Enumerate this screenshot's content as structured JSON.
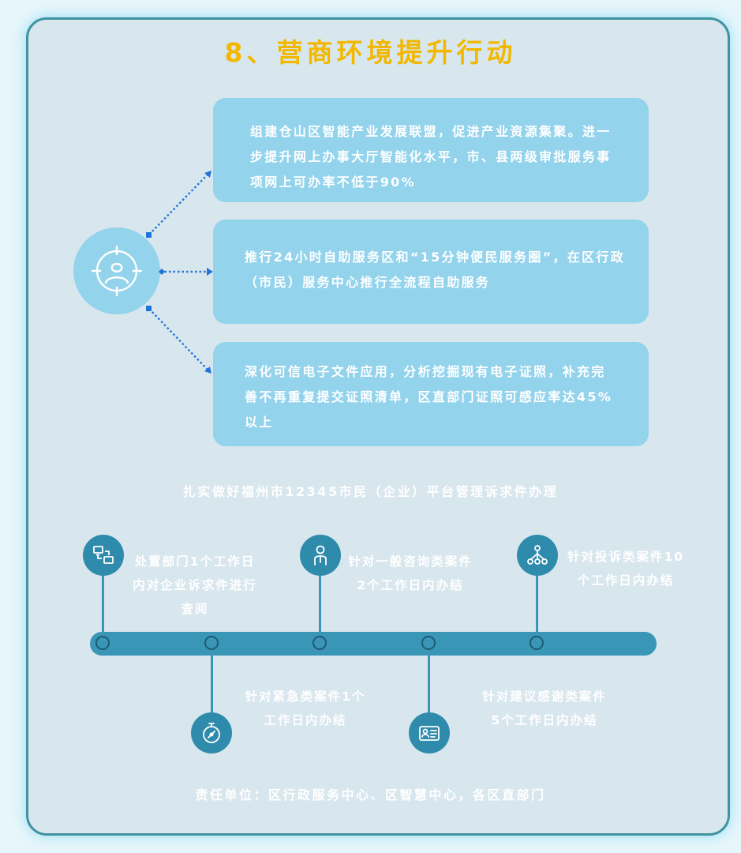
{
  "title": "8、营商环境提升行动",
  "actions": [
    "组建仓山区智能产业发展联盟，促进产业资源集聚。进一步提升网上办事大厅智能化水平，市、县两级审批服务事项网上可办率不低于90%",
    "推行24小时自助服务区和“15分钟便民服务圈”，在区行政（市民）服务中心推行全流程自助服务",
    "深化可信电子文件应用，分析挖掘现有电子证照，补充完善不再重复提交证照清单，区直部门证照可感应率达45%以上"
  ],
  "hotline_caption": "扎实做好福州市12345市民（企业）平台管理诉求件办理",
  "milestones": [
    {
      "text": "处置部门1个工作日内对企业诉求件进行查阅",
      "icon": "transfer-icon"
    },
    {
      "text": "针对紧急类案件1个工作日内办结",
      "icon": "stopwatch-icon"
    },
    {
      "text": "针对一般咨询类案件2个工作日内办结",
      "icon": "person-icon"
    },
    {
      "text": "针对建议感谢类案件5个工作日内办结",
      "icon": "id-card-icon"
    },
    {
      "text": "针对投诉类案件10个工作日内办结",
      "icon": "network-icon"
    }
  ],
  "responsible": "责任单位：区行政服务中心、区智慧中心，各区直部门",
  "colors": {
    "title": "#f2b800",
    "box": "#93d3ec",
    "timeline": "#3a96b6",
    "connector": "#1f74d8"
  }
}
